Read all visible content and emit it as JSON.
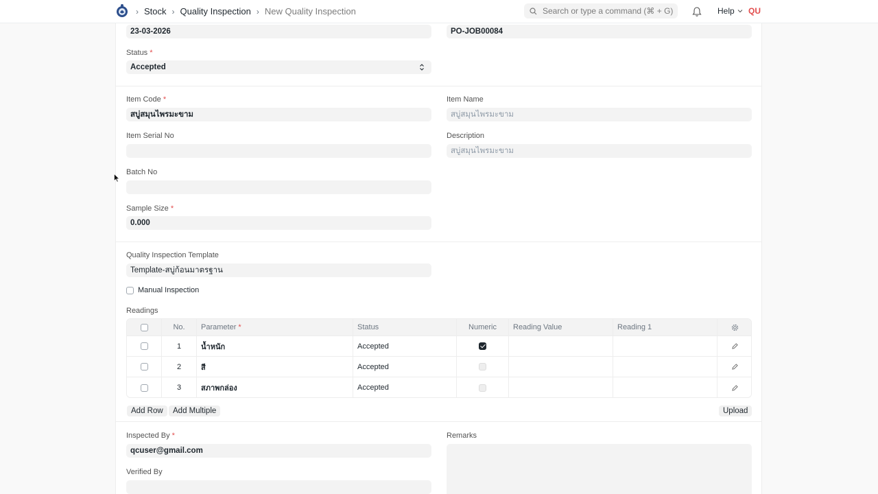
{
  "nav": {
    "breadcrumbs": [
      "Stock",
      "Quality Inspection",
      "New Quality Inspection"
    ],
    "search_placeholder": "Search or type a command (⌘ + G)",
    "help_label": "Help",
    "avatar_initials": "QU"
  },
  "form": {
    "report_date_value": "23-03-2026",
    "reference_value": "PO-JOB00084",
    "status_label": "Status",
    "status_value": "Accepted",
    "item_code_label": "Item Code",
    "item_code_value": "สบู่สมุนไพรมะขาม",
    "item_name_label": "Item Name",
    "item_name_value": "สบู่สมุนไพรมะขาม",
    "item_serial_label": "Item Serial No",
    "description_label": "Description",
    "description_value": "สบู่สมุนไพรมะขาม",
    "batch_label": "Batch No",
    "sample_size_label": "Sample Size",
    "sample_size_value": "0.000",
    "template_label": "Quality Inspection Template",
    "template_value": "Template-สบู่ก้อนมาตรฐาน",
    "manual_inspection_label": "Manual Inspection",
    "readings_label": "Readings",
    "inspected_by_label": "Inspected By",
    "inspected_by_value": "qcuser@gmail.com",
    "remarks_label": "Remarks",
    "verified_by_label": "Verified By",
    "required_mark": "*"
  },
  "readings": {
    "headers": {
      "no": "No.",
      "parameter": "Parameter",
      "status": "Status",
      "numeric": "Numeric",
      "reading_value": "Reading Value",
      "reading_1": "Reading 1"
    },
    "rows": [
      {
        "no": "1",
        "parameter": "น้ำหนัก",
        "status": "Accepted",
        "numeric": true
      },
      {
        "no": "2",
        "parameter": "สี",
        "status": "Accepted",
        "numeric": false
      },
      {
        "no": "3",
        "parameter": "สภาพกล่อง",
        "status": "Accepted",
        "numeric": false
      }
    ],
    "add_row_label": "Add Row",
    "add_multiple_label": "Add Multiple",
    "upload_label": "Upload"
  },
  "icons": [
    "app-logo-icon",
    "chevron-right-icon",
    "search-icon",
    "bell-icon",
    "chevron-down-icon",
    "select-arrows-icon",
    "gear-icon",
    "pencil-icon",
    "mouse-cursor-icon"
  ]
}
